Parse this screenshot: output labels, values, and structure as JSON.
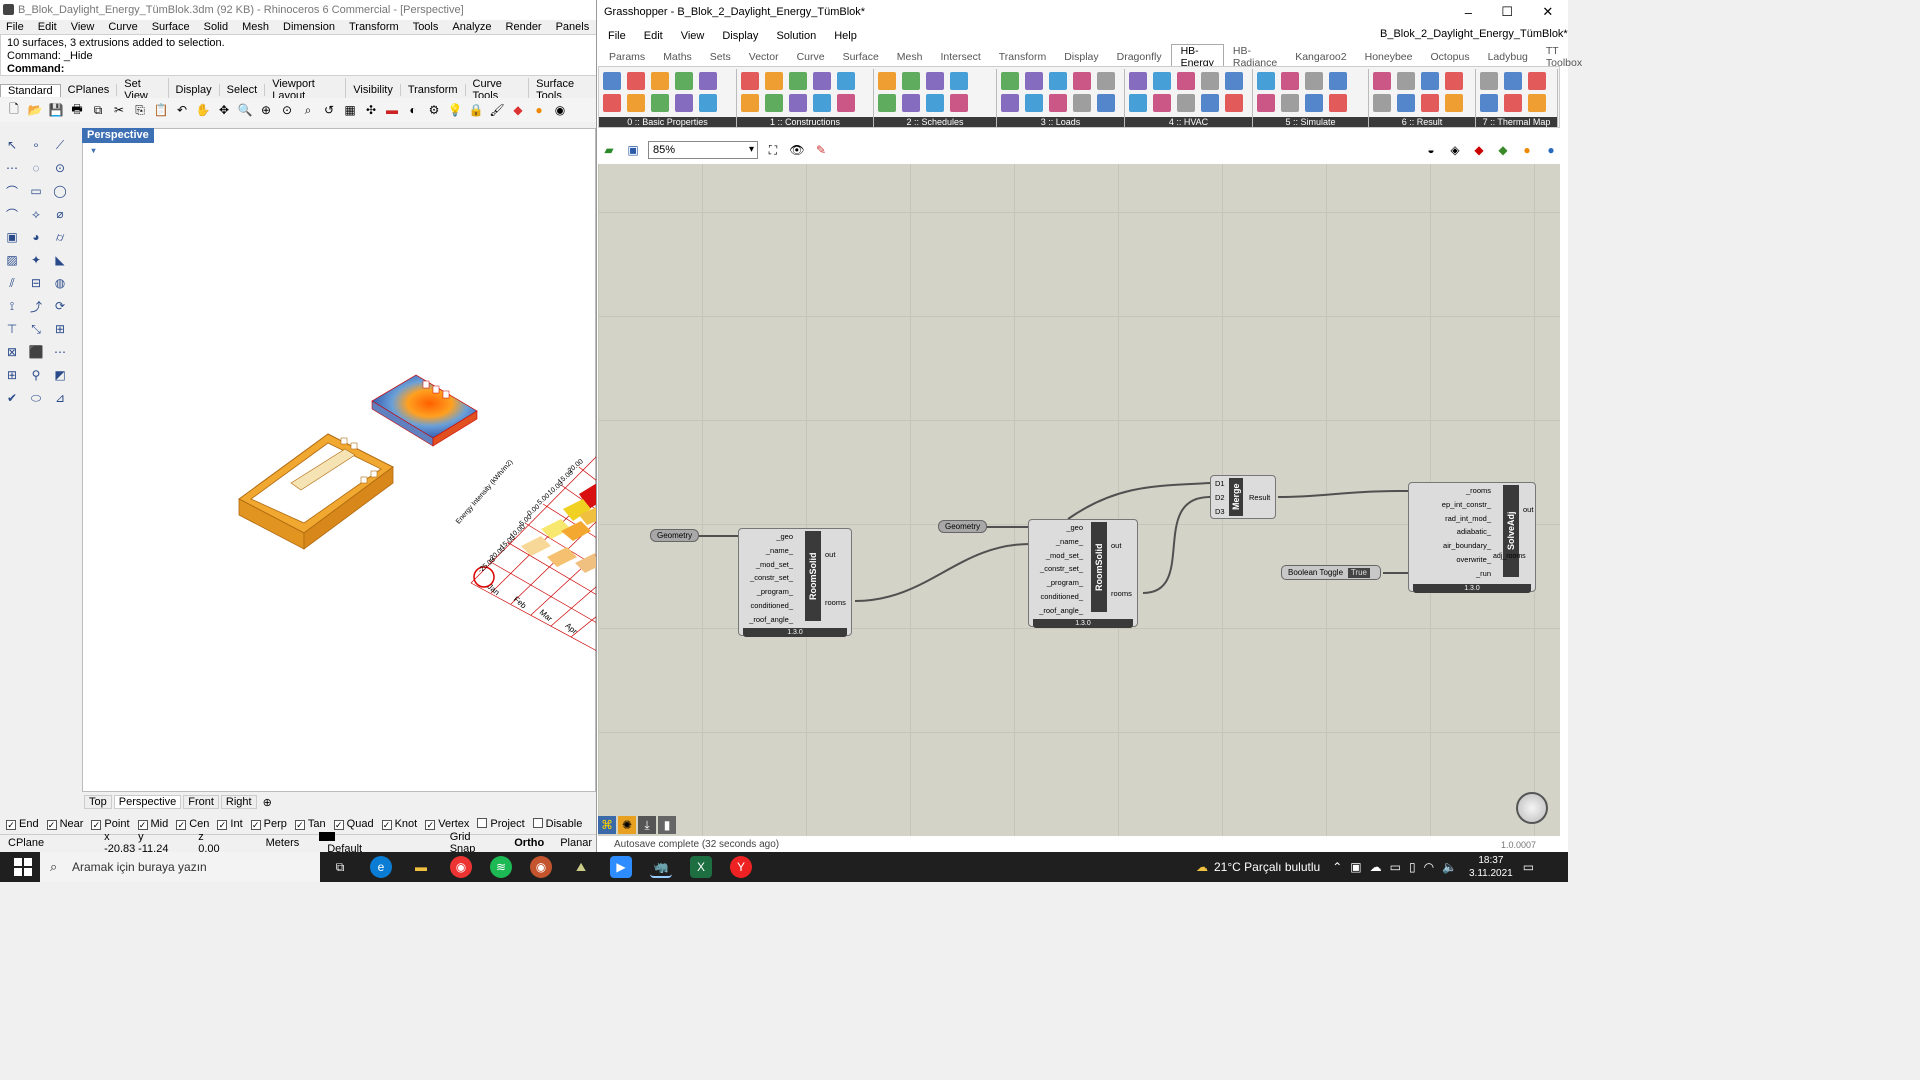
{
  "rhino": {
    "title": "B_Blok_Daylight_Energy_TümBlok.3dm (92 KB) - Rhinoceros 6 Commercial - [Perspective]",
    "menu": [
      "File",
      "Edit",
      "View",
      "Curve",
      "Surface",
      "Solid",
      "Mesh",
      "Dimension",
      "Transform",
      "Tools",
      "Analyze",
      "Render",
      "Panels",
      "Help"
    ],
    "command_lines": [
      "10 surfaces, 3 extrusions added to selection.",
      "Command: _Hide",
      "Command:"
    ],
    "toolbar_tabs": [
      "Standard",
      "CPlanes",
      "Set View",
      "Display",
      "Select",
      "Viewport Layout",
      "Visibility",
      "Transform",
      "Curve Tools",
      "Surface Tools"
    ],
    "viewport_label": "Perspective",
    "viewport_tabs": [
      "Top",
      "Perspective",
      "Front",
      "Right"
    ],
    "chart_axis_title": "Energy Intensity (kWh/m2)",
    "chart_ticks": [
      "20.00",
      "15.00",
      "10.00",
      "5.00",
      "0.00",
      "-5.00",
      "-10.00",
      "-15.00",
      "-20.00",
      "-25.00"
    ],
    "chart_months": [
      "Jan",
      "Feb",
      "Mar",
      "Apr"
    ],
    "osnaps": [
      {
        "label": "End",
        "checked": true
      },
      {
        "label": "Near",
        "checked": true
      },
      {
        "label": "Point",
        "checked": true
      },
      {
        "label": "Mid",
        "checked": true
      },
      {
        "label": "Cen",
        "checked": true
      },
      {
        "label": "Int",
        "checked": true
      },
      {
        "label": "Perp",
        "checked": true
      },
      {
        "label": "Tan",
        "checked": true
      },
      {
        "label": "Quad",
        "checked": true
      },
      {
        "label": "Knot",
        "checked": true
      },
      {
        "label": "Vertex",
        "checked": true
      },
      {
        "label": "Project",
        "checked": false
      },
      {
        "label": "Disable",
        "checked": false
      }
    ],
    "status": {
      "cplane": "CPlane",
      "x": "x -20.83",
      "y": "y -11.24",
      "z": "z 0.00",
      "units": "Meters",
      "layer": "Default",
      "grid_snap": "Grid Snap",
      "ortho": "Ortho",
      "planar": "Planar"
    }
  },
  "gh": {
    "title": "Grasshopper - B_Blok_2_Daylight_Energy_TümBlok*",
    "filename": "B_Blok_2_Daylight_Energy_TümBlok*",
    "menu": [
      "File",
      "Edit",
      "View",
      "Display",
      "Solution",
      "Help"
    ],
    "tabs": [
      "Params",
      "Maths",
      "Sets",
      "Vector",
      "Curve",
      "Surface",
      "Mesh",
      "Intersect",
      "Transform",
      "Display",
      "Dragonfly",
      "HB-Energy",
      "HB-Radiance",
      "Kangaroo2",
      "Honeybee",
      "Octopus",
      "Ladybug",
      "TT Toolbox"
    ],
    "active_tab": "HB-Energy",
    "ribbon_groups": [
      "0 :: Basic Properties",
      "1 :: Constructions",
      "2 :: Schedules",
      "3 :: Loads",
      "4 :: HVAC",
      "5 :: Simulate",
      "6 :: Result",
      "7 :: Thermal Map"
    ],
    "zoom": "85%",
    "status": "Autosave complete (32 seconds ago)",
    "version": "1.0.0007",
    "components": {
      "geometry1": "Geometry",
      "geometry2": "Geometry",
      "roomsolid_inputs": [
        "_geo",
        "_name_",
        "_mod_set_",
        "_constr_set_",
        "_program_",
        "conditioned_",
        "_roof_angle_"
      ],
      "roomsolid_name": "RoomSolid",
      "roomsolid_outputs": [
        "out",
        "rooms"
      ],
      "version": "1.3.0",
      "merge_name": "Merge",
      "merge_inputs": [
        "D1",
        "D2",
        "D3"
      ],
      "merge_output": "Result",
      "solveadj_name": "SolveAdj",
      "solveadj_inputs": [
        "_rooms",
        "ep_int_constr_",
        "rad_int_mod_",
        "adiabatic_",
        "air_boundary_",
        "overwrite_",
        "_run"
      ],
      "solveadj_outputs": [
        "out",
        "adj_rooms"
      ],
      "toggle_label": "Boolean Toggle",
      "toggle_value": "True"
    }
  },
  "taskbar": {
    "search_placeholder": "Aramak için buraya yazın",
    "weather": "21°C  Parçalı bulutlu",
    "time": "18:37",
    "date": "3.11.2021"
  },
  "colors": {
    "rhino_viewport_label": "#3d6fb4",
    "gh_canvas": "#d4d3c8",
    "taskbar": "#1f1f1f",
    "building": "#f0a830"
  }
}
